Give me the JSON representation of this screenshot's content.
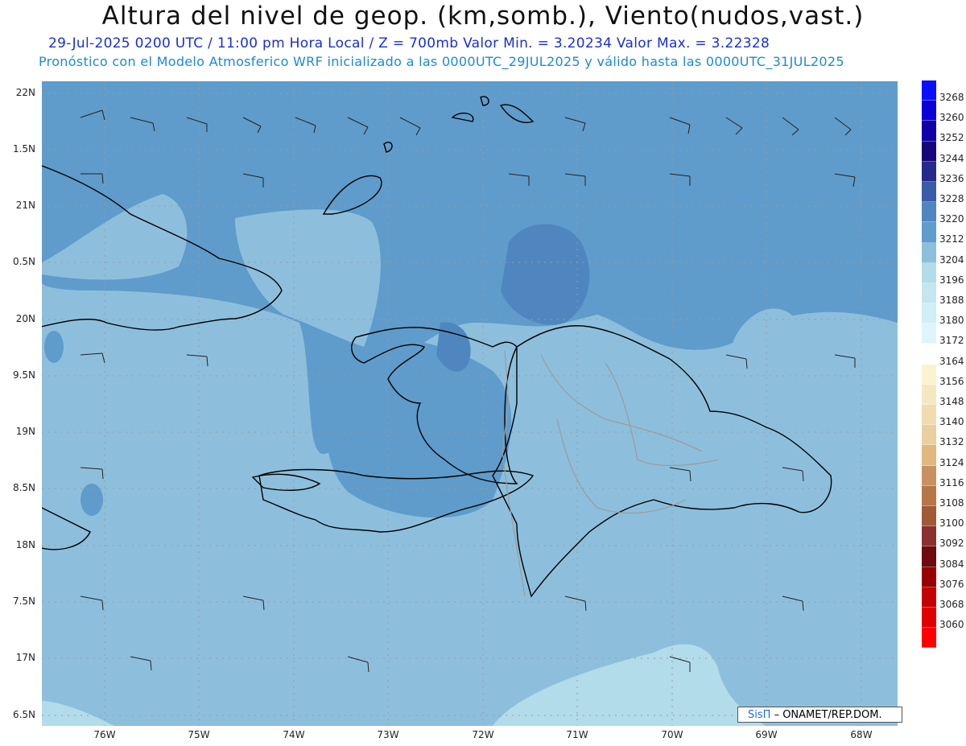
{
  "header": {
    "title": "Altura del nivel de geop. (km,somb.), Viento(nudos,vast.)",
    "subtitle1": "29-Jul-2025  0200 UTC / 11:00 pm Hora Local / Z = 700mb    Valor Min. = 3.20234  Valor Max. = 3.22328",
    "subtitle2": "Pronóstico con el Modelo Atmosferico WRF inicializado a las 0000UTC_29JUL2025 y válido hasta las  0000UTC_31JUL2025"
  },
  "map": {
    "lat_labels": [
      "22N",
      "1.5N",
      "21N",
      "0.5N",
      "20N",
      "9.5N",
      "19N",
      "8.5N",
      "18N",
      "7.5N",
      "17N",
      "6.5N"
    ],
    "lon_labels": [
      "76W",
      "75W",
      "74W",
      "73W",
      "72W",
      "71W",
      "70W",
      "69W",
      "68W"
    ],
    "colors": {
      "base": "#8dbfdd",
      "mid": "#5f9ccb",
      "high": "#4f86c0",
      "low": "#b3dcea",
      "coast": "#000000",
      "borders": "#9b9b9b",
      "barbs": "#222222"
    }
  },
  "colorbar": {
    "labels": [
      "3268",
      "3260",
      "3252",
      "3244",
      "3236",
      "3228",
      "3220",
      "3212",
      "3204",
      "3196",
      "3188",
      "3180",
      "3172",
      "3164",
      "3156",
      "3148",
      "3140",
      "3132",
      "3124",
      "3116",
      "3108",
      "3100",
      "3092",
      "3084",
      "3076",
      "3068",
      "3060"
    ],
    "colors": [
      "#0a10ff",
      "#0a00d8",
      "#1000a8",
      "#16087a",
      "#232a8c",
      "#3a5aa8",
      "#4f86c0",
      "#5f9ccb",
      "#8dbfdd",
      "#b3dcea",
      "#c3e6f0",
      "#d2eef6",
      "#dff5fb",
      "#ffffff",
      "#fbf3d0",
      "#f5e8c0",
      "#f0dcb0",
      "#ead0a0",
      "#e0b880",
      "#c99060",
      "#b57748",
      "#a05a38",
      "#8a3030",
      "#6e0a10",
      "#9a0000",
      "#c40000",
      "#e00000",
      "#ff0000"
    ]
  },
  "credit": {
    "sis": "SisΠ",
    "org": "– ONAMET/REP.DOM."
  }
}
